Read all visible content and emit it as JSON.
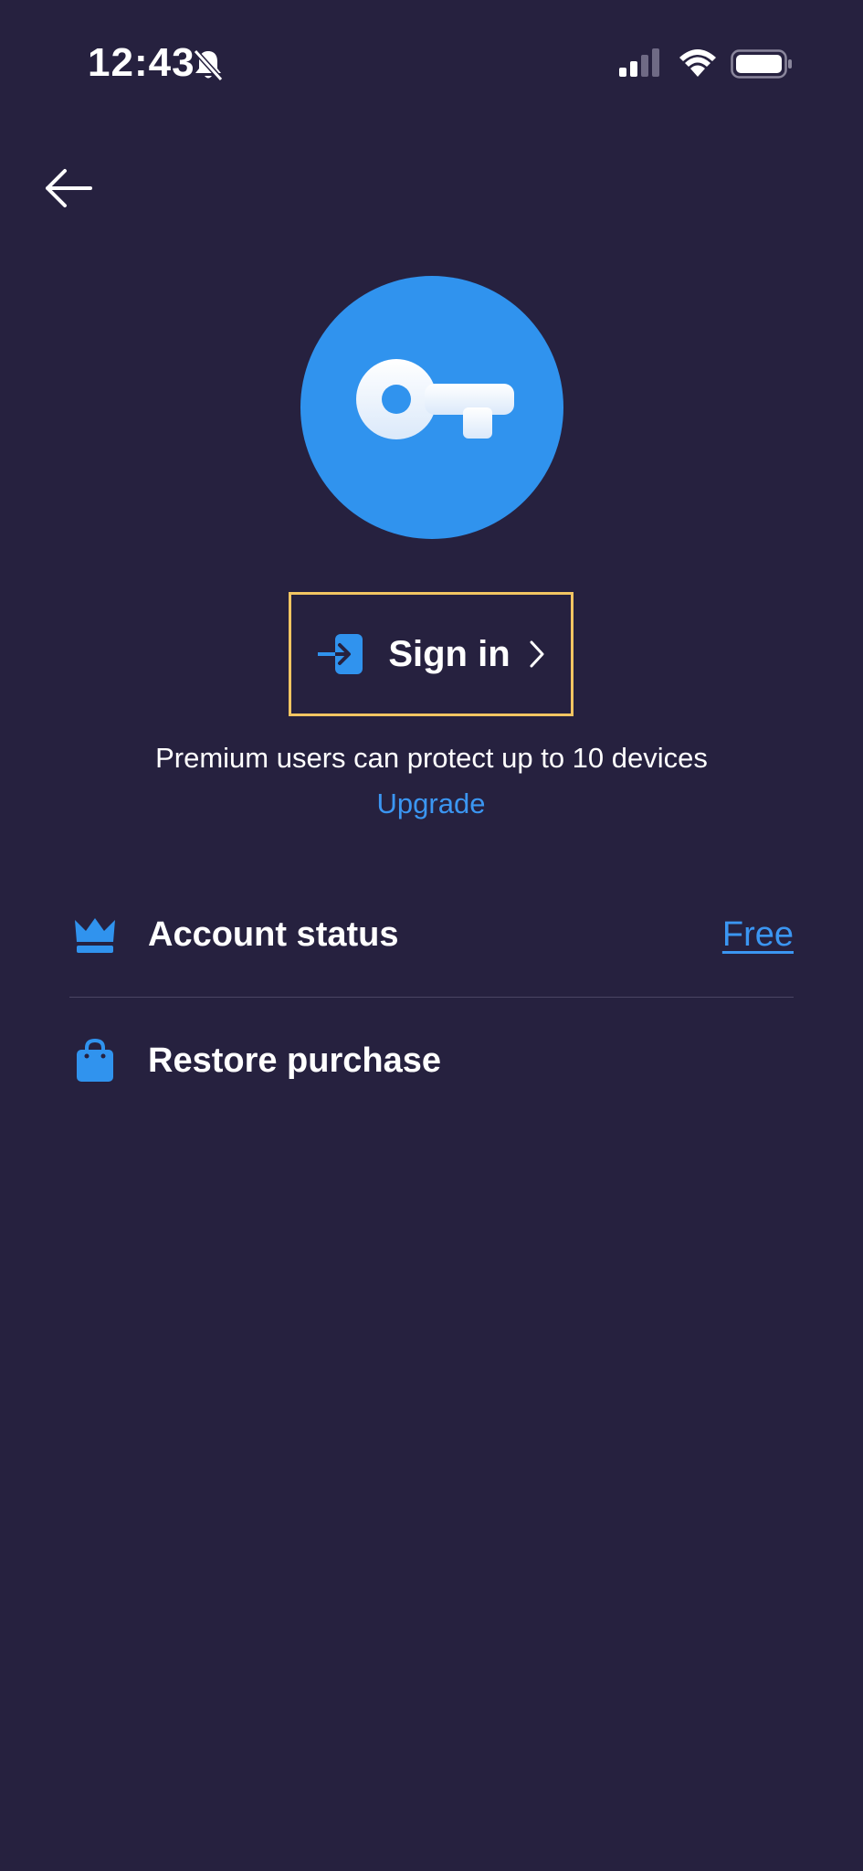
{
  "status_bar": {
    "time": "12:43"
  },
  "colors": {
    "background": "#26213f",
    "accent": "#3093ee",
    "link": "#3b96f2",
    "highlight_border": "#f2c562"
  },
  "header": {
    "back_icon": "arrow-left-icon"
  },
  "hero": {
    "icon": "key-icon"
  },
  "signin": {
    "label": "Sign in",
    "icon": "sign-in-icon",
    "chevron": "chevron-right-icon"
  },
  "premium": {
    "text": "Premium users can protect up to 10 devices",
    "upgrade_label": "Upgrade"
  },
  "rows": {
    "account_status": {
      "icon": "crown-icon",
      "label": "Account status",
      "value": "Free"
    },
    "restore_purchase": {
      "icon": "shopping-bag-icon",
      "label": "Restore purchase"
    }
  }
}
